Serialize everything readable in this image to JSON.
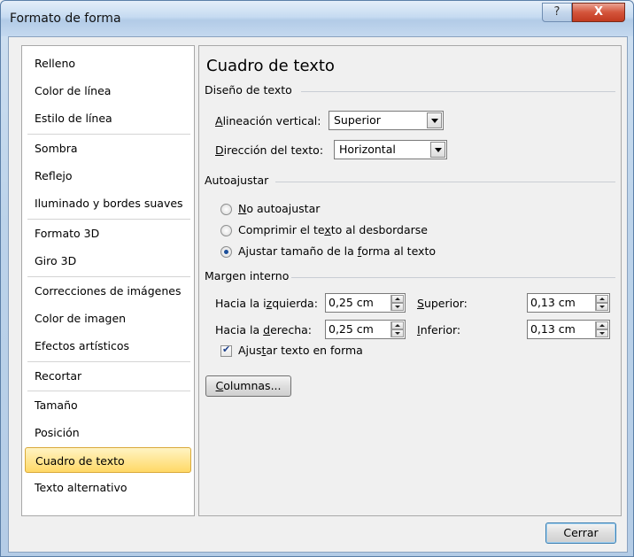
{
  "window": {
    "title": "Formato de forma",
    "help_glyph": "?",
    "close_glyph": "X"
  },
  "nav": {
    "items": [
      "Relleno",
      "Color de línea",
      "Estilo de línea",
      "Sombra",
      "Reflejo",
      "Iluminado y bordes suaves",
      "Formato 3D",
      "Giro 3D",
      "Correcciones de imágenes",
      "Color de imagen",
      "Efectos artísticos",
      "Recortar",
      "Tamaño",
      "Posición",
      "Cuadro de texto",
      "Texto alternativo"
    ],
    "selected": "Cuadro de texto"
  },
  "panel": {
    "title": "Cuadro de texto",
    "layout_group": {
      "heading": "Diseño de texto",
      "vertical_label_pre": "",
      "vertical_label_key": "A",
      "vertical_label_post": "lineación vertical:",
      "vertical_value": "Superior",
      "direction_label_key": "D",
      "direction_label_post": "irección del texto:",
      "direction_value": "Horizontal"
    },
    "autofit_group": {
      "heading": "Autoajustar",
      "opt1_key": "N",
      "opt1_post": "o autoajustar",
      "opt2_pre": "Comprimir el te",
      "opt2_key": "x",
      "opt2_post": "to al desbordarse",
      "opt3_pre": "Ajustar tamaño de la ",
      "opt3_key": "f",
      "opt3_post": "orma al texto",
      "selected": 3
    },
    "margin_group": {
      "heading": "Margen interno",
      "left_pre": "Hacia la i",
      "left_key": "z",
      "left_post": "quierda:",
      "left_value": "0,25 cm",
      "right_pre": "Hacia la ",
      "right_key": "d",
      "right_post": "erecha:",
      "right_value": "0,25 cm",
      "top_key": "S",
      "top_post": "uperior:",
      "top_value": "0,13 cm",
      "bottom_key": "I",
      "bottom_post": "nferior:",
      "bottom_value": "0,13 cm"
    },
    "wrap": {
      "pre": "Ajus",
      "key": "t",
      "post": "ar texto en forma",
      "checked": true
    },
    "columns_key": "C",
    "columns_post": "olumnas..."
  },
  "footer": {
    "close_label": "Cerrar"
  }
}
